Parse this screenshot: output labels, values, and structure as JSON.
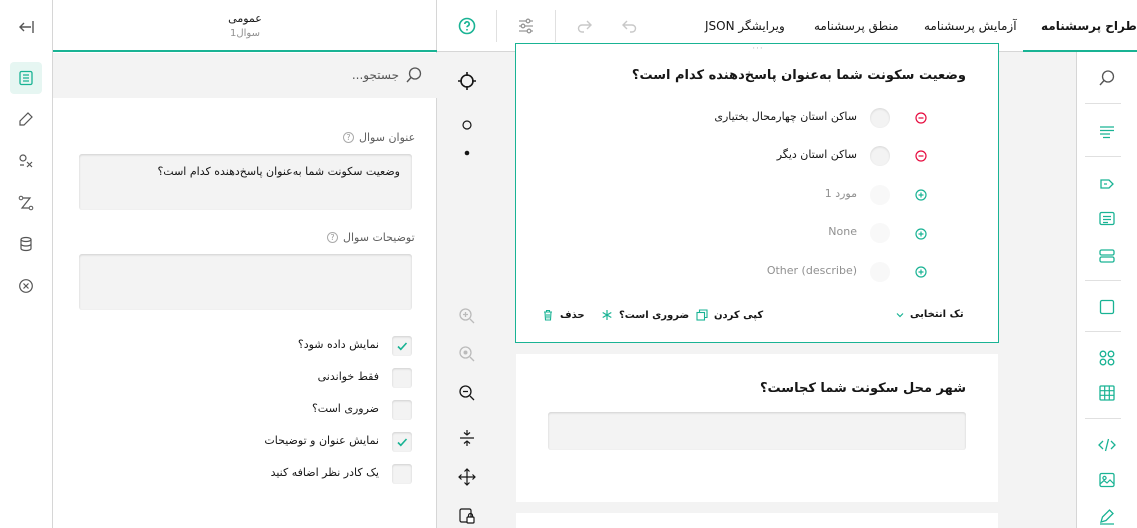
{
  "colors": {
    "accent": "#19b394",
    "danger": "#e60a3e",
    "text": "#161616",
    "muted": "#909090"
  },
  "topbar": {
    "tabs": [
      {
        "label": "طراح پرسشنامه",
        "active": true
      },
      {
        "label": "آزمایش پرسشنامه",
        "active": false
      },
      {
        "label": "منطق پرسشنامه",
        "active": false
      },
      {
        "label": "ویرایشگر JSON",
        "active": false
      }
    ],
    "icons": [
      "undo-icon",
      "redo-icon",
      "settings-icon",
      "help-icon"
    ]
  },
  "props": {
    "title": "عمومی",
    "subtitle": "سوال1",
    "search_placeholder": "جستجو...",
    "question_title_label": "عنوان سوال",
    "question_title_value": "وضعیت سکونت شما به‌عنوان پاسخ‌دهنده کدام است؟",
    "question_desc_label": "توضیحات سوال",
    "question_desc_value": "",
    "checkboxes": [
      {
        "label": "نمایش داده شود؟",
        "checked": true
      },
      {
        "label": "فقط خواندنی",
        "checked": false
      },
      {
        "label": "ضروری است؟",
        "checked": false
      },
      {
        "label": "نمایش عنوان و توضیحات",
        "checked": true
      },
      {
        "label": "یک کادر نظر اضافه کنید",
        "checked": false
      }
    ]
  },
  "question1": {
    "title": "وضعیت سکونت شما به‌عنوان پاسخ‌دهنده کدام است؟",
    "choices": [
      {
        "text": "ساکن استان چهارمحال بختیاری",
        "action": "remove"
      },
      {
        "text": "ساکن استان دیگر",
        "action": "remove"
      },
      {
        "text": "مورد 1",
        "action": "add"
      },
      {
        "text": "None",
        "action": "add"
      },
      {
        "text": "Other (describe)",
        "action": "add"
      }
    ],
    "type_label": "تک انتخابی",
    "copy_label": "کپی کردن",
    "required_label": "ضروری است؟",
    "delete_label": "حذف"
  },
  "question2": {
    "title": "شهر محل سکونت شما کجاست؟"
  }
}
